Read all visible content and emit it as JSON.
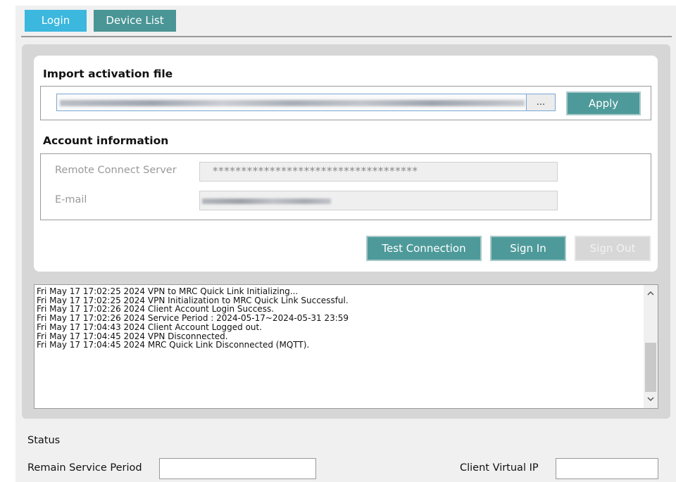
{
  "tabs": [
    {
      "label": "Login",
      "active": true
    },
    {
      "label": "Device List",
      "active": false
    }
  ],
  "import": {
    "title": "Import activation file",
    "file_path_redacted": true,
    "browse_label": "...",
    "apply_label": "Apply"
  },
  "account": {
    "title": "Account information",
    "server_label": "Remote Connect Server",
    "server_value": "************************************",
    "email_label": "E-mail",
    "email_redacted": true
  },
  "actions": {
    "test_label": "Test Connection",
    "signin_label": "Sign In",
    "signout_label": "Sign Out",
    "signout_enabled": false
  },
  "log": [
    "Fri May 17 17:02:25 2024 VPN to MRC Quick Link Initializing...",
    "Fri May 17 17:02:25 2024 VPN Initialization to MRC Quick Link Successful.",
    "Fri May 17 17:02:26 2024 Client Account Login Success.",
    "Fri May 17 17:02:26 2024 Service Period : 2024-05-17~2024-05-31 23:59",
    "Fri May 17 17:04:43 2024 Client Account Logged out.",
    "Fri May 17 17:04:45 2024 VPN Disconnected.",
    "Fri May 17 17:04:45 2024 MRC Quick Link Disconnected (MQTT)."
  ],
  "status": {
    "title": "Status",
    "remain_label": "Remain Service Period",
    "remain_value": "",
    "ip_label": "Client Virtual IP",
    "ip_value": ""
  },
  "icons": {
    "scroll_up": "chevron-up-icon",
    "scroll_down": "chevron-down-icon"
  },
  "colors": {
    "tab_active": "#3cb7de",
    "tab_inactive": "#4a9595",
    "button_primary": "#4e9a9a",
    "button_disabled": "#d7d7d7"
  }
}
